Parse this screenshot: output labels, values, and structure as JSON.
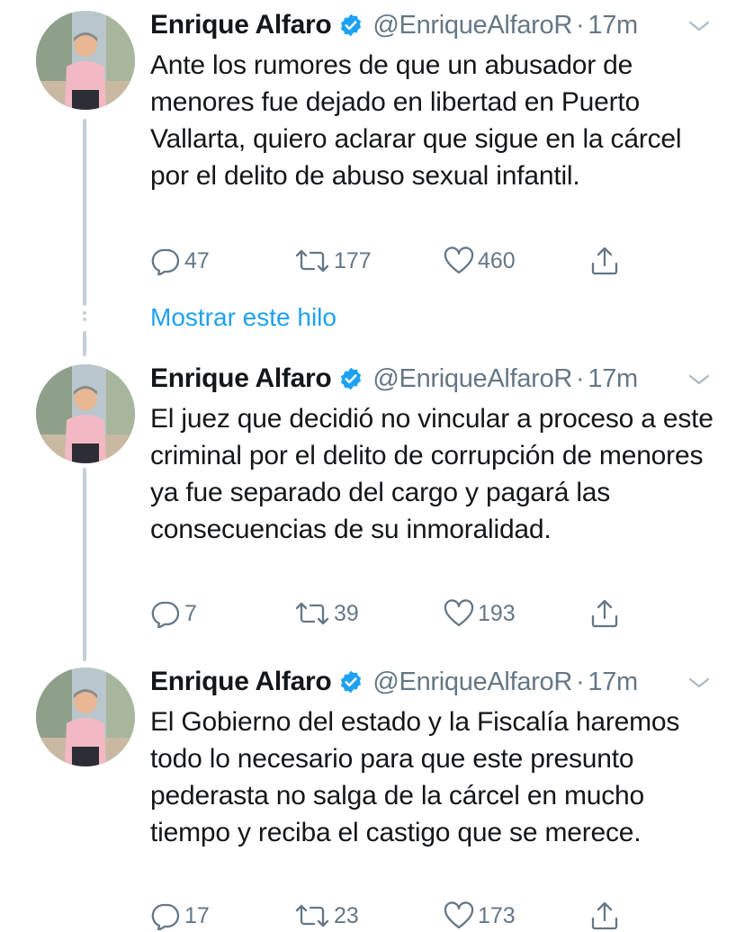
{
  "show_thread_label": "Mostrar este hilo",
  "colors": {
    "accent": "#1da1f2",
    "secondary": "#657786",
    "text": "#14171a"
  },
  "tweets": [
    {
      "author_name": "Enrique Alfaro",
      "handle": "@EnriqueAlfaroR",
      "separator": "·",
      "time": "17m",
      "text": "Ante los rumores de que un abusador de menores fue dejado en libertad en Puerto Vallarta, quiero aclarar que sigue en la cárcel por el delito de abuso sexual infantil.",
      "reply_count": "47",
      "retweet_count": "177",
      "like_count": "460"
    },
    {
      "author_name": "Enrique Alfaro",
      "handle": "@EnriqueAlfaroR",
      "separator": "·",
      "time": "17m",
      "text": "El juez que decidió no vincular a proceso a este criminal por el delito de corrupción de menores ya fue separado del cargo y pagará las consecuencias de su inmoralidad.",
      "reply_count": "7",
      "retweet_count": "39",
      "like_count": "193"
    },
    {
      "author_name": "Enrique Alfaro",
      "handle": "@EnriqueAlfaroR",
      "separator": "·",
      "time": "17m",
      "text": "El Gobierno del estado y la Fiscalía haremos todo lo necesario para que este presunto pederasta no salga de la cárcel en mucho tiempo y reciba el castigo que se merece.",
      "reply_count": "17",
      "retweet_count": "23",
      "like_count": "173"
    }
  ]
}
